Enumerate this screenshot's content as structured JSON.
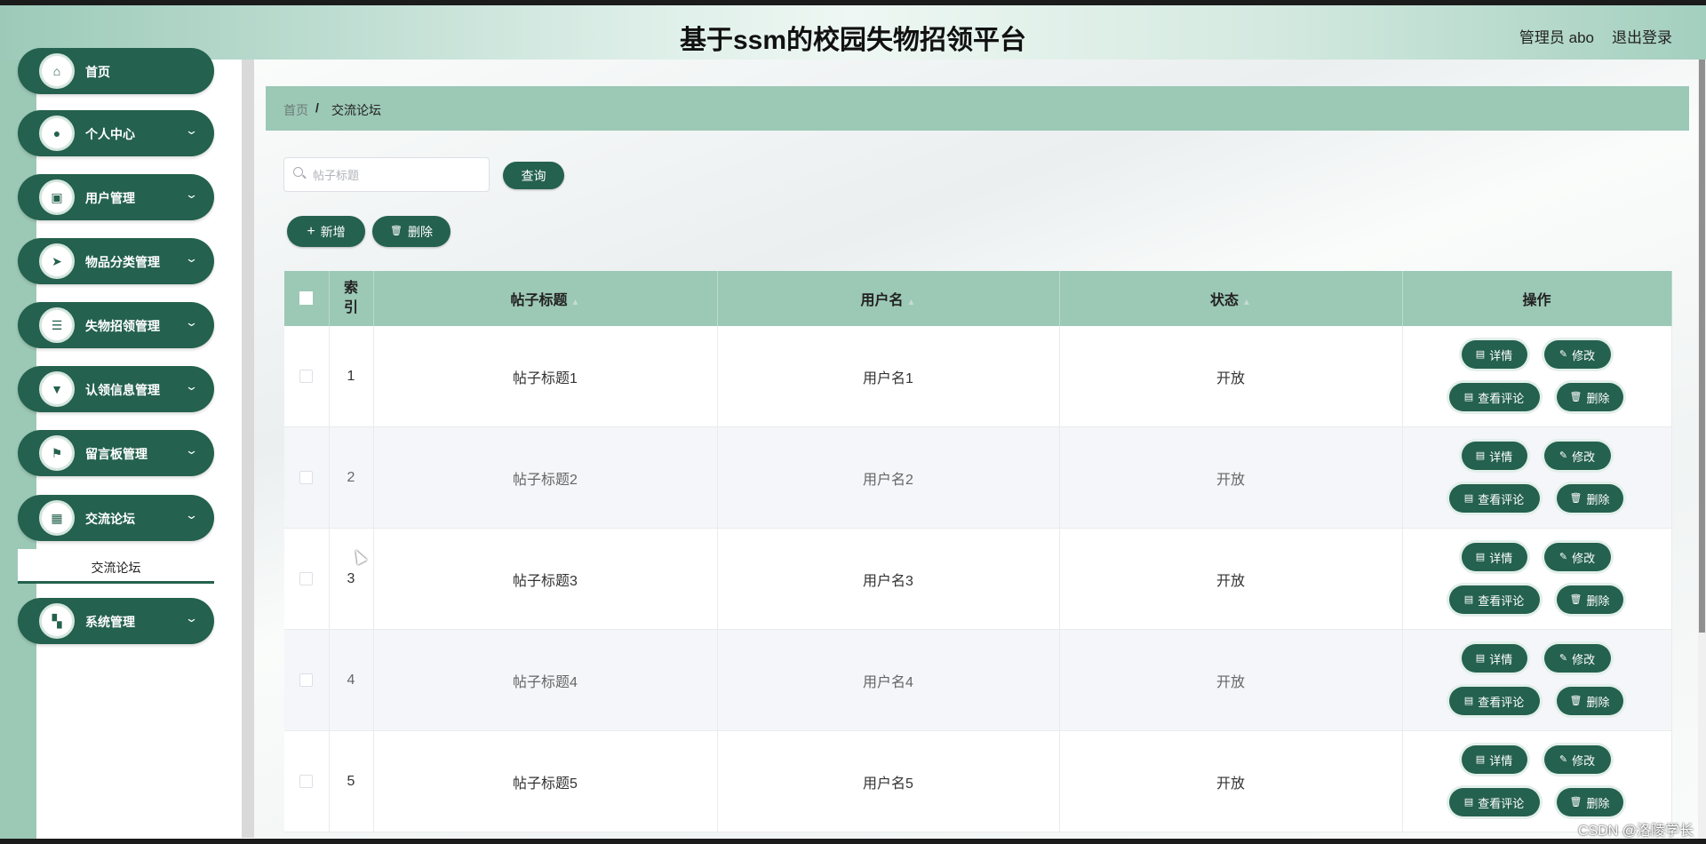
{
  "header": {
    "title": "基于ssm的校园失物招领平台",
    "admin": "管理员 abo",
    "logout": "退出登录"
  },
  "sidebar": {
    "items": [
      {
        "label": "首页",
        "icon": "home-icon"
      },
      {
        "label": "个人中心",
        "icon": "user-icon"
      },
      {
        "label": "用户管理",
        "icon": "clipboard-icon"
      },
      {
        "label": "物品分类管理",
        "icon": "send-icon"
      },
      {
        "label": "失物招领管理",
        "icon": "sliders-icon"
      },
      {
        "label": "认领信息管理",
        "icon": "stamp-icon"
      },
      {
        "label": "留言板管理",
        "icon": "flag-icon"
      },
      {
        "label": "交流论坛",
        "icon": "grid-icon"
      },
      {
        "label": "系统管理",
        "icon": "apps-icon"
      }
    ],
    "sub_item": "交流论坛"
  },
  "breadcrumb": {
    "home": "首页",
    "separator": "/",
    "current": "交流论坛"
  },
  "search": {
    "placeholder": "帖子标题",
    "value": "",
    "query_button": "查询"
  },
  "toolbar": {
    "add": "新增",
    "delete": "删除"
  },
  "table": {
    "headers": {
      "index": "索引",
      "title": "帖子标题",
      "username": "用户名",
      "status": "状态",
      "actions": "操作"
    },
    "rows": [
      {
        "index": "1",
        "title": "帖子标题1",
        "username": "用户名1",
        "status": "开放"
      },
      {
        "index": "2",
        "title": "帖子标题2",
        "username": "用户名2",
        "status": "开放"
      },
      {
        "index": "3",
        "title": "帖子标题3",
        "username": "用户名3",
        "status": "开放"
      },
      {
        "index": "4",
        "title": "帖子标题4",
        "username": "用户名4",
        "status": "开放"
      },
      {
        "index": "5",
        "title": "帖子标题5",
        "username": "用户名5",
        "status": "开放"
      }
    ],
    "row_actions": {
      "detail": "详情",
      "edit": "修改",
      "comments": "查看评论",
      "delete": "删除"
    }
  },
  "watermark": "CSDN @洛陵学长",
  "colors": {
    "primary": "#24614e",
    "accent": "#9cc8b6"
  }
}
